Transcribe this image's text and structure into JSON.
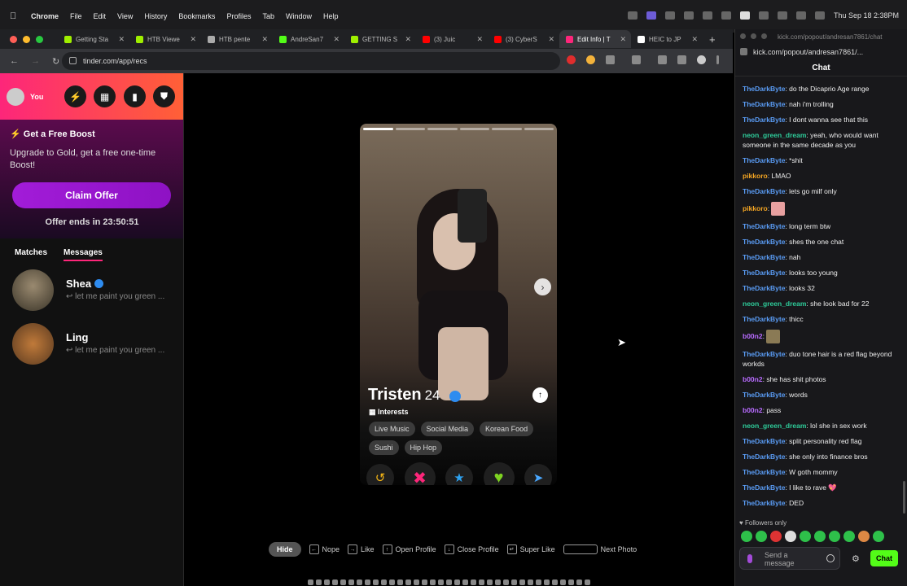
{
  "menubar": {
    "app": "Chrome",
    "items": [
      "File",
      "Edit",
      "View",
      "History",
      "Bookmarks",
      "Profiles",
      "Tab",
      "Window",
      "Help"
    ],
    "clock": "Thu Sep 18  2:38PM"
  },
  "tabs": [
    {
      "label": "Getting Sta",
      "color": "#9fef00"
    },
    {
      "label": "HTB Viewe",
      "color": "#9fef00"
    },
    {
      "label": "HTB pente",
      "color": "#aaaaaa"
    },
    {
      "label": "AndreSan7",
      "color": "#53fc18"
    },
    {
      "label": "GETTING S",
      "color": "#9fef00"
    },
    {
      "label": "(3) Juic",
      "color": "#ff0000"
    },
    {
      "label": "(3) CyberS",
      "color": "#ff0000"
    },
    {
      "label": "Edit Info | T",
      "color": "#fd267a"
    },
    {
      "label": "HEIC to JP",
      "color": "#ffffff"
    }
  ],
  "url": "tinder.com/app/recs",
  "left": {
    "you_label": "You",
    "boost_title": "Get a Free Boost",
    "boost_desc": "Upgrade to Gold, get a free one-time Boost!",
    "claim_label": "Claim Offer",
    "offer_ends": "Offer ends in 23:50:51",
    "tab_matches": "Matches",
    "tab_messages": "Messages",
    "messages": [
      {
        "name": "Shea",
        "preview": "let me paint you green ..."
      },
      {
        "name": "Ling",
        "preview": "let me paint you green ..."
      }
    ]
  },
  "profile": {
    "name": "Tristen",
    "age": "24",
    "interests_label": "Interests",
    "interests": [
      "Live Music",
      "Social Media",
      "Korean Food",
      "Sushi",
      "Hip Hop"
    ]
  },
  "shortcuts": {
    "hide": "Hide",
    "nope": "Nope",
    "like": "Like",
    "open_profile": "Open Profile",
    "close_profile": "Close Profile",
    "super_like": "Super Like",
    "next_photo": "Next Photo"
  },
  "kick": {
    "title": "kick.com/popout/andresan7861/chat",
    "url": "kick.com/popout/andresan7861/...",
    "header": "Chat",
    "followers_only": "Followers only",
    "input_placeholder": "Send a message",
    "send_label": "Chat",
    "messages": [
      {
        "user": "TheDarkByte",
        "color": "#5a9cf5",
        "text": "do the Dicaprio Age range"
      },
      {
        "user": "TheDarkByte",
        "color": "#5a9cf5",
        "text": "nah i'm trolling"
      },
      {
        "user": "TheDarkByte",
        "color": "#5a9cf5",
        "text": "I dont wanna see that this"
      },
      {
        "user": "neon_green_dream",
        "color": "#2ecc9a",
        "text": "yeah, who would want someone in the same decade as you"
      },
      {
        "user": "TheDarkByte",
        "color": "#5a9cf5",
        "text": "*shit"
      },
      {
        "user": "pikkoro",
        "color": "#f5a623",
        "text": "LMAO"
      },
      {
        "user": "TheDarkByte",
        "color": "#5a9cf5",
        "text": "lets go milf only"
      },
      {
        "user": "pikkoro",
        "color": "#f5a623",
        "text": "",
        "emote": "#e8a0a0"
      },
      {
        "user": "TheDarkByte",
        "color": "#5a9cf5",
        "text": "long term btw"
      },
      {
        "user": "TheDarkByte",
        "color": "#5a9cf5",
        "text": "shes the one chat"
      },
      {
        "user": "TheDarkByte",
        "color": "#5a9cf5",
        "text": "nah"
      },
      {
        "user": "TheDarkByte",
        "color": "#5a9cf5",
        "text": "looks too young"
      },
      {
        "user": "TheDarkByte",
        "color": "#5a9cf5",
        "text": "looks 32"
      },
      {
        "user": "neon_green_dream",
        "color": "#2ecc9a",
        "text": "she look bad for 22"
      },
      {
        "user": "TheDarkByte",
        "color": "#5a9cf5",
        "text": "thicc"
      },
      {
        "user": "b00n2",
        "color": "#b86bff",
        "text": "",
        "emote": "#8a7a55"
      },
      {
        "user": "TheDarkByte",
        "color": "#5a9cf5",
        "text": "duo tone hair is a red flag beyond workds"
      },
      {
        "user": "b00n2",
        "color": "#b86bff",
        "text": "she has shit photos"
      },
      {
        "user": "TheDarkByte",
        "color": "#5a9cf5",
        "text": "words"
      },
      {
        "user": "b00n2",
        "color": "#b86bff",
        "text": "pass"
      },
      {
        "user": "neon_green_dream",
        "color": "#2ecc9a",
        "text": "lol she in sex work"
      },
      {
        "user": "TheDarkByte",
        "color": "#5a9cf5",
        "text": "split personality red flag"
      },
      {
        "user": "TheDarkByte",
        "color": "#5a9cf5",
        "text": "she only into finance bros"
      },
      {
        "user": "TheDarkByte",
        "color": "#5a9cf5",
        "text": "W goth mommy"
      },
      {
        "user": "TheDarkByte",
        "color": "#5a9cf5",
        "text": "I like to rave 💖"
      },
      {
        "user": "TheDarkByte",
        "color": "#5a9cf5",
        "text": "DED"
      }
    ]
  },
  "colors": {
    "tinder_pink": "#fd267a",
    "tinder_orange": "#ff6036",
    "kick_green": "#53fc18"
  }
}
